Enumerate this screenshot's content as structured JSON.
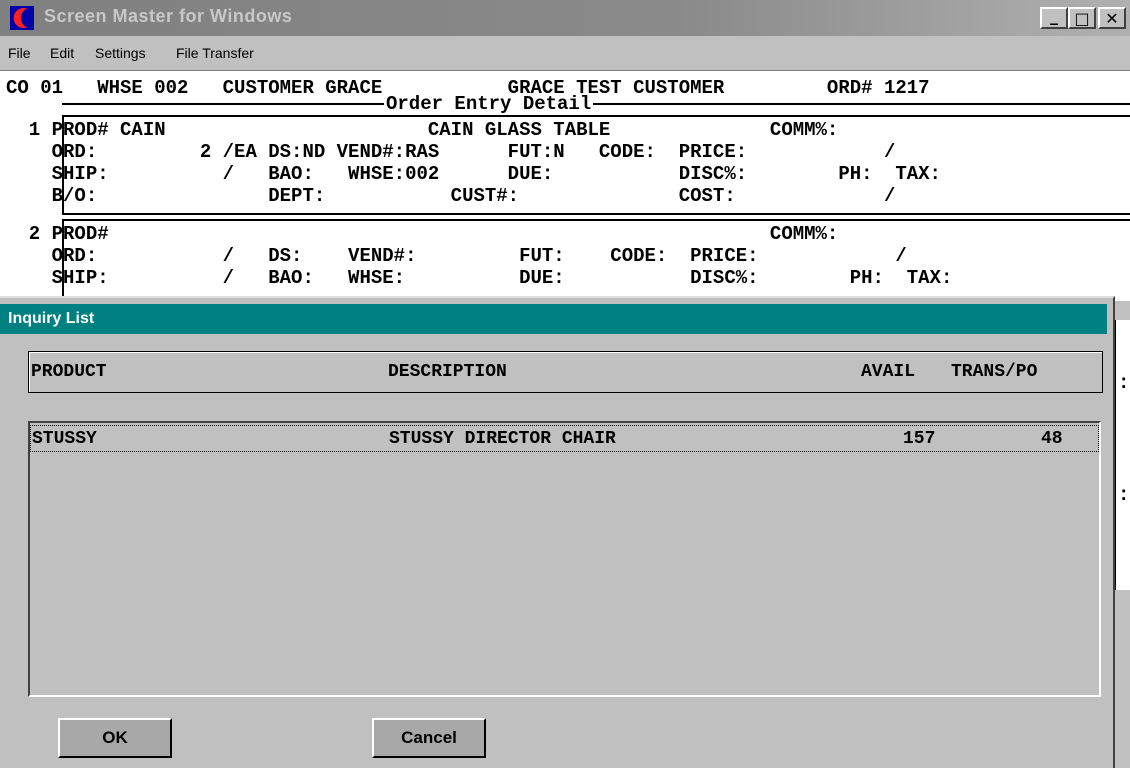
{
  "window": {
    "title": "Screen Master  for  Windows",
    "minimize": "_",
    "maximize": "□",
    "close": "✕"
  },
  "menu": [
    "File",
    "Edit",
    "Settings",
    "File Transfer"
  ],
  "terminal": {
    "header": "CO 01   WHSE 002   CUSTOMER GRACE           GRACE TEST CUSTOMER         ORD# 1217",
    "section_title": "Order Entry Detail",
    "item1": [
      "  1 PROD# CAIN                       CAIN GLASS TABLE              COMM%:",
      "    ORD:         2 /EA DS:ND VEND#:RAS      FUT:N   CODE:  PRICE:            /",
      "    SHIP:          /   BAO:   WHSE:002      DUE:           DISC%:        PH:  TAX:",
      "    B/O:               DEPT:           CUST#:              COST:             /"
    ],
    "item2": [
      "  2 PROD#                                                          COMM%:",
      "    ORD:           /   DS:    VEND#:         FUT:    CODE:  PRICE:            /",
      "    SHIP:          /   BAO:   WHSE:          DUE:           DISC%:        PH:  TAX:"
    ]
  },
  "dialog": {
    "title": "Inquiry List",
    "columns": {
      "product": "PRODUCT",
      "description": "DESCRIPTION",
      "avail": "AVAIL",
      "trans_po": "TRANS/PO"
    },
    "rows": [
      {
        "product": "STUSSY",
        "description": "STUSSY DIRECTOR CHAIR",
        "avail": "157",
        "trans_po": "48"
      }
    ],
    "ok_label": "OK",
    "cancel_label": "Cancel"
  },
  "side_fragments": [
    ":",
    ":"
  ]
}
